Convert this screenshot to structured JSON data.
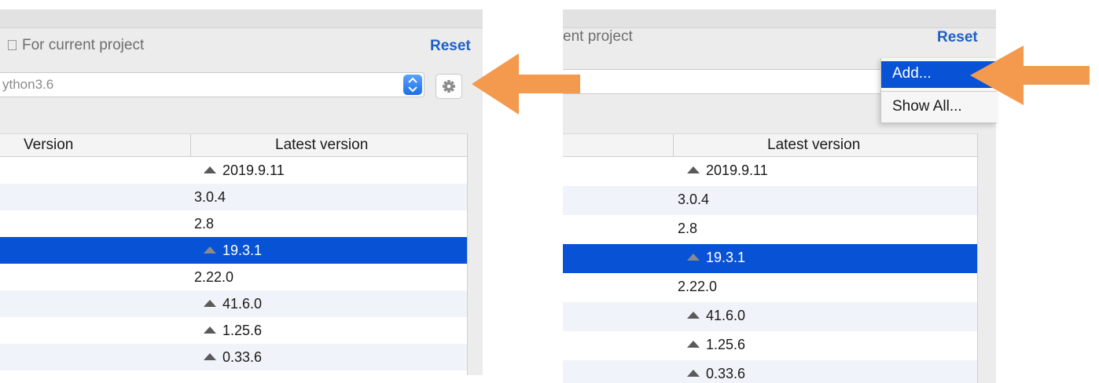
{
  "left": {
    "title": "For current project",
    "reset": "Reset",
    "interpreter": "ython3.6",
    "columns": [
      "Version",
      "Latest version"
    ],
    "rows": [
      {
        "latest": "2019.9.11",
        "upgrade": true
      },
      {
        "latest": "3.0.4",
        "upgrade": false
      },
      {
        "latest": "2.8",
        "upgrade": false
      },
      {
        "latest": "19.3.1",
        "upgrade": true,
        "selected": true
      },
      {
        "latest": "2.22.0",
        "upgrade": false
      },
      {
        "latest": "41.6.0",
        "upgrade": true
      },
      {
        "latest": "1.25.6",
        "upgrade": true
      },
      {
        "latest": "0.33.6",
        "upgrade": true
      }
    ]
  },
  "right": {
    "title": "ent project",
    "reset": "Reset",
    "menu": [
      "Add...",
      "Show All..."
    ],
    "columns": [
      "Latest version"
    ],
    "rows": [
      {
        "latest": "2019.9.11",
        "upgrade": true
      },
      {
        "latest": "3.0.4",
        "upgrade": false
      },
      {
        "latest": "2.8",
        "upgrade": false
      },
      {
        "latest": "19.3.1",
        "upgrade": true,
        "selected": true
      },
      {
        "latest": "2.22.0",
        "upgrade": false
      },
      {
        "latest": "41.6.0",
        "upgrade": true
      },
      {
        "latest": "1.25.6",
        "upgrade": true
      },
      {
        "latest": "0.33.6",
        "upgrade": true
      }
    ]
  },
  "colors": {
    "accent": "#0852d5",
    "arrow": "#f39a4f",
    "link": "#1f5fc4"
  },
  "icons": {
    "gear": "gear-icon",
    "stepper": "stepper-icon",
    "upgrade": "upgrade-triangle-icon",
    "project": "project-icon"
  }
}
